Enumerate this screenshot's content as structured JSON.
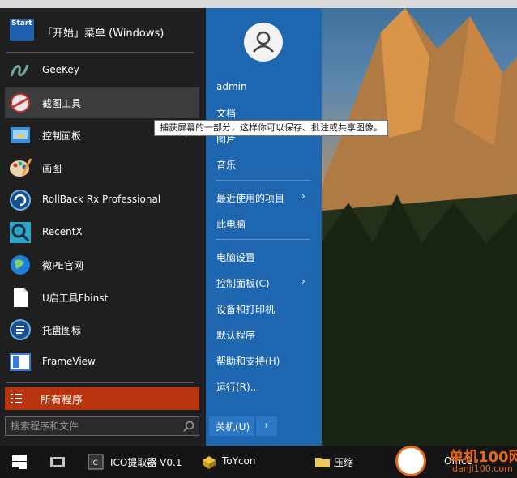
{
  "start_menu": {
    "header": {
      "logo_text": "Start",
      "title": "「开始」菜单 (Windows)"
    },
    "programs": [
      {
        "label": "GeeKey",
        "icon": "geekey-icon"
      },
      {
        "label": "截图工具",
        "icon": "snipping-tool-icon"
      },
      {
        "label": "控制面板",
        "icon": "control-panel-icon",
        "has_submenu": true
      },
      {
        "label": "画图",
        "icon": "paint-icon"
      },
      {
        "label": "RollBack Rx Professional",
        "icon": "rollback-icon"
      },
      {
        "label": "RecentX",
        "icon": "recentx-icon"
      },
      {
        "label": "微PE官网",
        "icon": "globe-icon"
      },
      {
        "label": "U启工具Fbinst",
        "icon": "document-icon"
      },
      {
        "label": "托盘图标",
        "icon": "tray-icon"
      },
      {
        "label": "FrameView",
        "icon": "frameview-icon"
      }
    ],
    "all_programs": "所有程序",
    "search": {
      "placeholder": "搜索程序和文件"
    },
    "right_panel": {
      "user": "admin",
      "items": [
        {
          "label": "文档"
        },
        {
          "label": "图片"
        },
        {
          "label": "音乐"
        },
        {
          "label": "最近使用的项目",
          "has_submenu": true
        },
        {
          "label": "此电脑"
        },
        {
          "label": "电脑设置"
        },
        {
          "label": "控制面板(C)",
          "has_submenu": true
        },
        {
          "label": "设备和打印机"
        },
        {
          "label": "默认程序"
        },
        {
          "label": "帮助和支持(H)"
        },
        {
          "label": "运行(R)..."
        }
      ],
      "arrow": "›"
    },
    "shutdown": {
      "label": "关机(U)",
      "arrow": "›"
    }
  },
  "tooltip": "捕获屏幕的一部分，这样你可以保存、批注或共享图像。",
  "taskbar": {
    "apps": [
      {
        "label": "ICO提取器 V0.1"
      },
      {
        "label": "ToYcon"
      },
      {
        "label": "压缩"
      },
      {
        "label": "Office"
      }
    ]
  },
  "watermark": {
    "text": "单机100网",
    "url": "danji100.com"
  },
  "colors": {
    "accent": "#1f66b1",
    "all_programs": "#b8340f",
    "menu_bg": "#1f1f1f"
  }
}
